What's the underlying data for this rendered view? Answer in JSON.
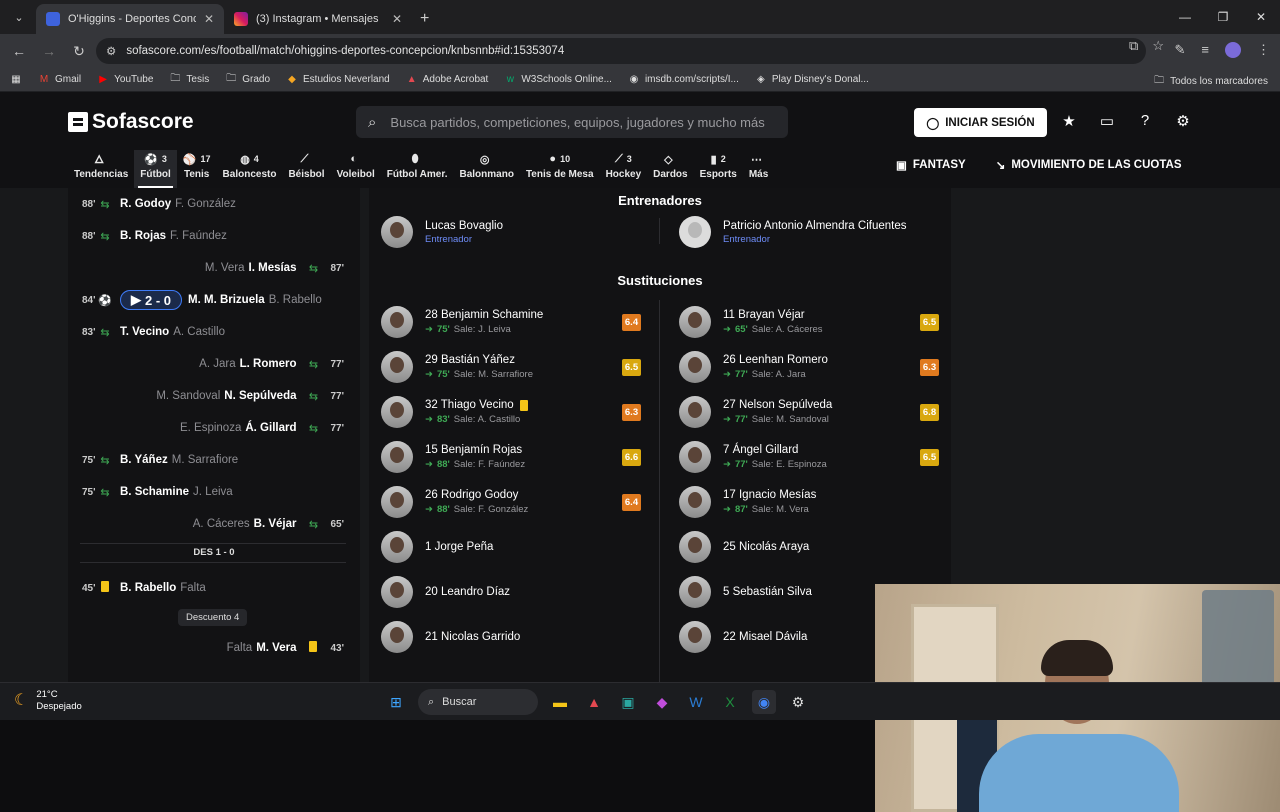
{
  "browser": {
    "tabs": [
      {
        "title": "O'Higgins - Deportes Concepción",
        "active": true,
        "icon": "sofascore-favicon"
      },
      {
        "title": "(3) Instagram • Mensajes",
        "active": false,
        "icon": "instagram-favicon"
      }
    ],
    "url": "sofascore.com/es/football/match/ohiggins-deportes-concepcion/knbsnnb#id:15353074",
    "bookmarks": [
      "Gmail",
      "YouTube",
      "Tesis",
      "Grado",
      "Estudios Neverland",
      "Adobe Acrobat",
      "W3Schools Online...",
      "imsdb.com/scripts/I...",
      "Play Disney's Donal..."
    ],
    "all_bookmarks": "Todos los marcadores"
  },
  "site": {
    "logo": "Sofascore",
    "search_placeholder": "Busca partidos, competiciones, equipos, jugadores y mucho más",
    "login": "INICIAR SESIÓN",
    "sports": [
      {
        "label": "Tendencias",
        "count": "",
        "icon": "flame-icon"
      },
      {
        "label": "Fútbol",
        "count": "3",
        "icon": "soccer-ball-icon",
        "active": true
      },
      {
        "label": "Tenis",
        "count": "17",
        "icon": "tennis-icon"
      },
      {
        "label": "Baloncesto",
        "count": "4",
        "icon": "basketball-icon"
      },
      {
        "label": "Béisbol",
        "count": "",
        "icon": "baseball-icon"
      },
      {
        "label": "Voleibol",
        "count": "",
        "icon": "volleyball-icon"
      },
      {
        "label": "Fútbol Amer.",
        "count": "",
        "icon": "american-football-icon"
      },
      {
        "label": "Balonmano",
        "count": "",
        "icon": "handball-icon"
      },
      {
        "label": "Tenis de Mesa",
        "count": "10",
        "icon": "table-tennis-icon"
      },
      {
        "label": "Hockey",
        "count": "3",
        "icon": "hockey-icon"
      },
      {
        "label": "Dardos",
        "count": "",
        "icon": "darts-icon"
      },
      {
        "label": "Esports",
        "count": "2",
        "icon": "esports-icon"
      },
      {
        "label": "Más",
        "count": "",
        "icon": "more-icon"
      }
    ],
    "fantasy": "FANTASY",
    "odds": "MOVIMIENTO DE LAS CUOTAS"
  },
  "timeline": {
    "events": [
      {
        "min": "88'",
        "side": "left",
        "type": "sub",
        "main": "R. Godoy",
        "sub": "F. González"
      },
      {
        "min": "88'",
        "side": "left",
        "type": "sub",
        "main": "B. Rojas",
        "sub": "F. Faúndez"
      },
      {
        "min": "87'",
        "side": "right",
        "type": "sub",
        "main": "I. Mesías",
        "sub": "M. Vera"
      },
      {
        "min": "84'",
        "side": "left",
        "type": "goal",
        "score": "2 - 0",
        "main": "M. M. Brizuela",
        "sub": "B. Rabello"
      },
      {
        "min": "83'",
        "side": "left",
        "type": "sub",
        "main": "T. Vecino",
        "sub": "A. Castillo"
      },
      {
        "min": "77'",
        "side": "right",
        "type": "sub",
        "main": "L. Romero",
        "sub": "A. Jara"
      },
      {
        "min": "77'",
        "side": "right",
        "type": "sub",
        "main": "N. Sepúlveda",
        "sub": "M. Sandoval"
      },
      {
        "min": "77'",
        "side": "right",
        "type": "sub",
        "main": "Á. Gillard",
        "sub": "E. Espinoza"
      },
      {
        "min": "75'",
        "side": "left",
        "type": "sub",
        "main": "B. Yáñez",
        "sub": "M. Sarrafiore"
      },
      {
        "min": "75'",
        "side": "left",
        "type": "sub",
        "main": "B. Schamine",
        "sub": "J. Leiva"
      },
      {
        "min": "65'",
        "side": "right",
        "type": "sub",
        "main": "B. Véjar",
        "sub": "A. Cáceres"
      }
    ],
    "halftime": "DES 1 - 0",
    "card_event": {
      "min": "45'",
      "main": "B. Rabello",
      "sub": "Falta"
    },
    "stoppage": "Descuento 4",
    "card_event2": {
      "min": "43'",
      "main": "M. Vera",
      "sub": "Falta"
    }
  },
  "lineups": {
    "coaches_title": "Entrenadores",
    "coaches": [
      {
        "name": "Lucas Bovaglio",
        "role": "Entrenador"
      },
      {
        "name": "Patricio Antonio Almendra Cifuentes",
        "role": "Entrenador"
      }
    ],
    "subs_title": "Sustituciones",
    "home_subs": [
      {
        "name": "28 Benjamin Schamine",
        "min": "75'",
        "out": "Sale: J. Leiva",
        "rating": "6.4",
        "color": "#e07a1f"
      },
      {
        "name": "29 Bastián Yáñez",
        "min": "75'",
        "out": "Sale: M. Sarrafiore",
        "rating": "6.5",
        "color": "#d9a80f"
      },
      {
        "name": "32 Thiago Vecino",
        "min": "83'",
        "out": "Sale: A. Castillo",
        "rating": "6.3",
        "color": "#e07a1f",
        "card": true
      },
      {
        "name": "15 Benjamín Rojas",
        "min": "88'",
        "out": "Sale: F. Faúndez",
        "rating": "6.6",
        "color": "#d9a80f"
      },
      {
        "name": "26 Rodrigo Godoy",
        "min": "88'",
        "out": "Sale: F. González",
        "rating": "6.4",
        "color": "#e07a1f"
      },
      {
        "name": "1 Jorge Peña"
      },
      {
        "name": "20 Leandro Díaz"
      },
      {
        "name": "21 Nicolas Garrido"
      }
    ],
    "away_subs": [
      {
        "name": "11 Brayan Véjar",
        "min": "65'",
        "out": "Sale: A. Cáceres",
        "rating": "6.5",
        "color": "#d9a80f"
      },
      {
        "name": "26 Leenhan Romero",
        "min": "77'",
        "out": "Sale: A. Jara",
        "rating": "6.3",
        "color": "#e07a1f"
      },
      {
        "name": "27 Nelson Sepúlveda",
        "min": "77'",
        "out": "Sale: M. Sandoval",
        "rating": "6.8",
        "color": "#d9a80f"
      },
      {
        "name": "7 Ángel Gillard",
        "min": "77'",
        "out": "Sale: E. Espinoza",
        "rating": "6.5",
        "color": "#d9a80f"
      },
      {
        "name": "17 Ignacio Mesías",
        "min": "87'",
        "out": "Sale: M. Vera"
      },
      {
        "name": "25 Nicolás Araya"
      },
      {
        "name": "5 Sebastián Silva"
      },
      {
        "name": "22 Misael Dávila"
      }
    ]
  },
  "taskbar": {
    "temp": "21°C",
    "weather": "Despejado",
    "search": "Buscar"
  }
}
